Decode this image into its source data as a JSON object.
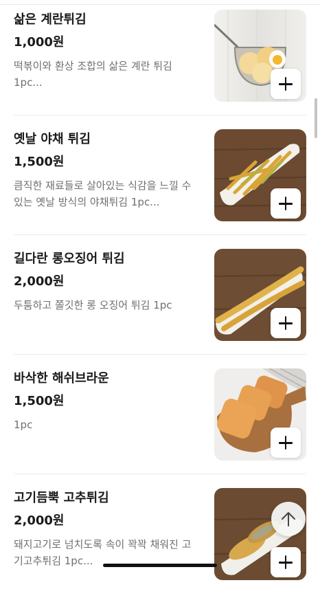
{
  "menu": {
    "items": [
      {
        "name": "삶은 계란튀김",
        "price": "1,000원",
        "desc": "떡볶이와 환상 조합의 삶은 계란 튀김 1pc..."
      },
      {
        "name": "옛날 야채 튀김",
        "price": "1,500원",
        "desc": "큼직한 재료들로 살아있는 식감을 느낄 수 있는 옛날 방식의 야채튀김 1pc..."
      },
      {
        "name": "길다란 롱오징어 튀김",
        "price": "2,000원",
        "desc": "두툼하고 쫄깃한 롱 오징어 튀김 1pc"
      },
      {
        "name": "바삭한 해쉬브라운",
        "price": "1,500원",
        "desc": "1pc"
      },
      {
        "name": "고기듬뿍 고추튀김",
        "price": "2,000원",
        "desc": "돼지고기로 넘치도록 속이 꽉꽉 채워진 고기고추튀김 1pc..."
      }
    ]
  },
  "icons": {
    "add": "plus-icon",
    "scroll_top": "arrow-up-icon"
  },
  "colors": {
    "text_primary": "#1a1a1a",
    "text_secondary": "#6f6f6f",
    "divider": "#ebebeb"
  }
}
